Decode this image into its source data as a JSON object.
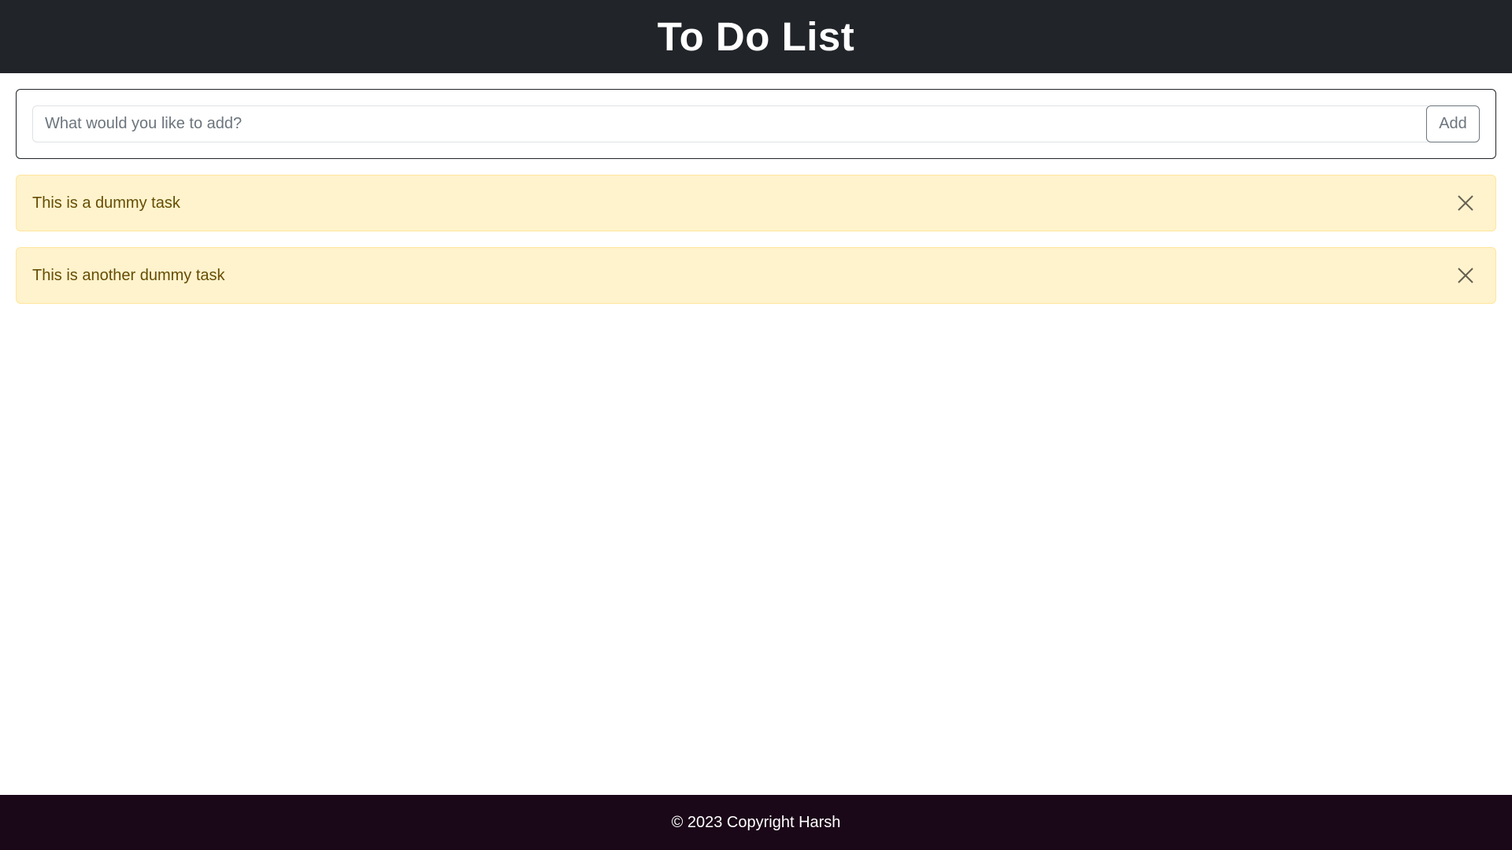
{
  "header": {
    "title": "To Do List"
  },
  "add_form": {
    "placeholder": "What would you like to add?",
    "value": "",
    "button_label": "Add"
  },
  "tasks": [
    {
      "text": "This is a dummy task",
      "close_icon": "close-icon"
    },
    {
      "text": "This is another dummy task",
      "close_icon": "close-icon"
    }
  ],
  "footer": {
    "copyright": "© 2023 Copyright Harsh"
  },
  "colors": {
    "header_bg": "#212529",
    "task_bg": "#fff3cd",
    "task_text": "#664d03",
    "footer_bg": "#1a0718"
  }
}
